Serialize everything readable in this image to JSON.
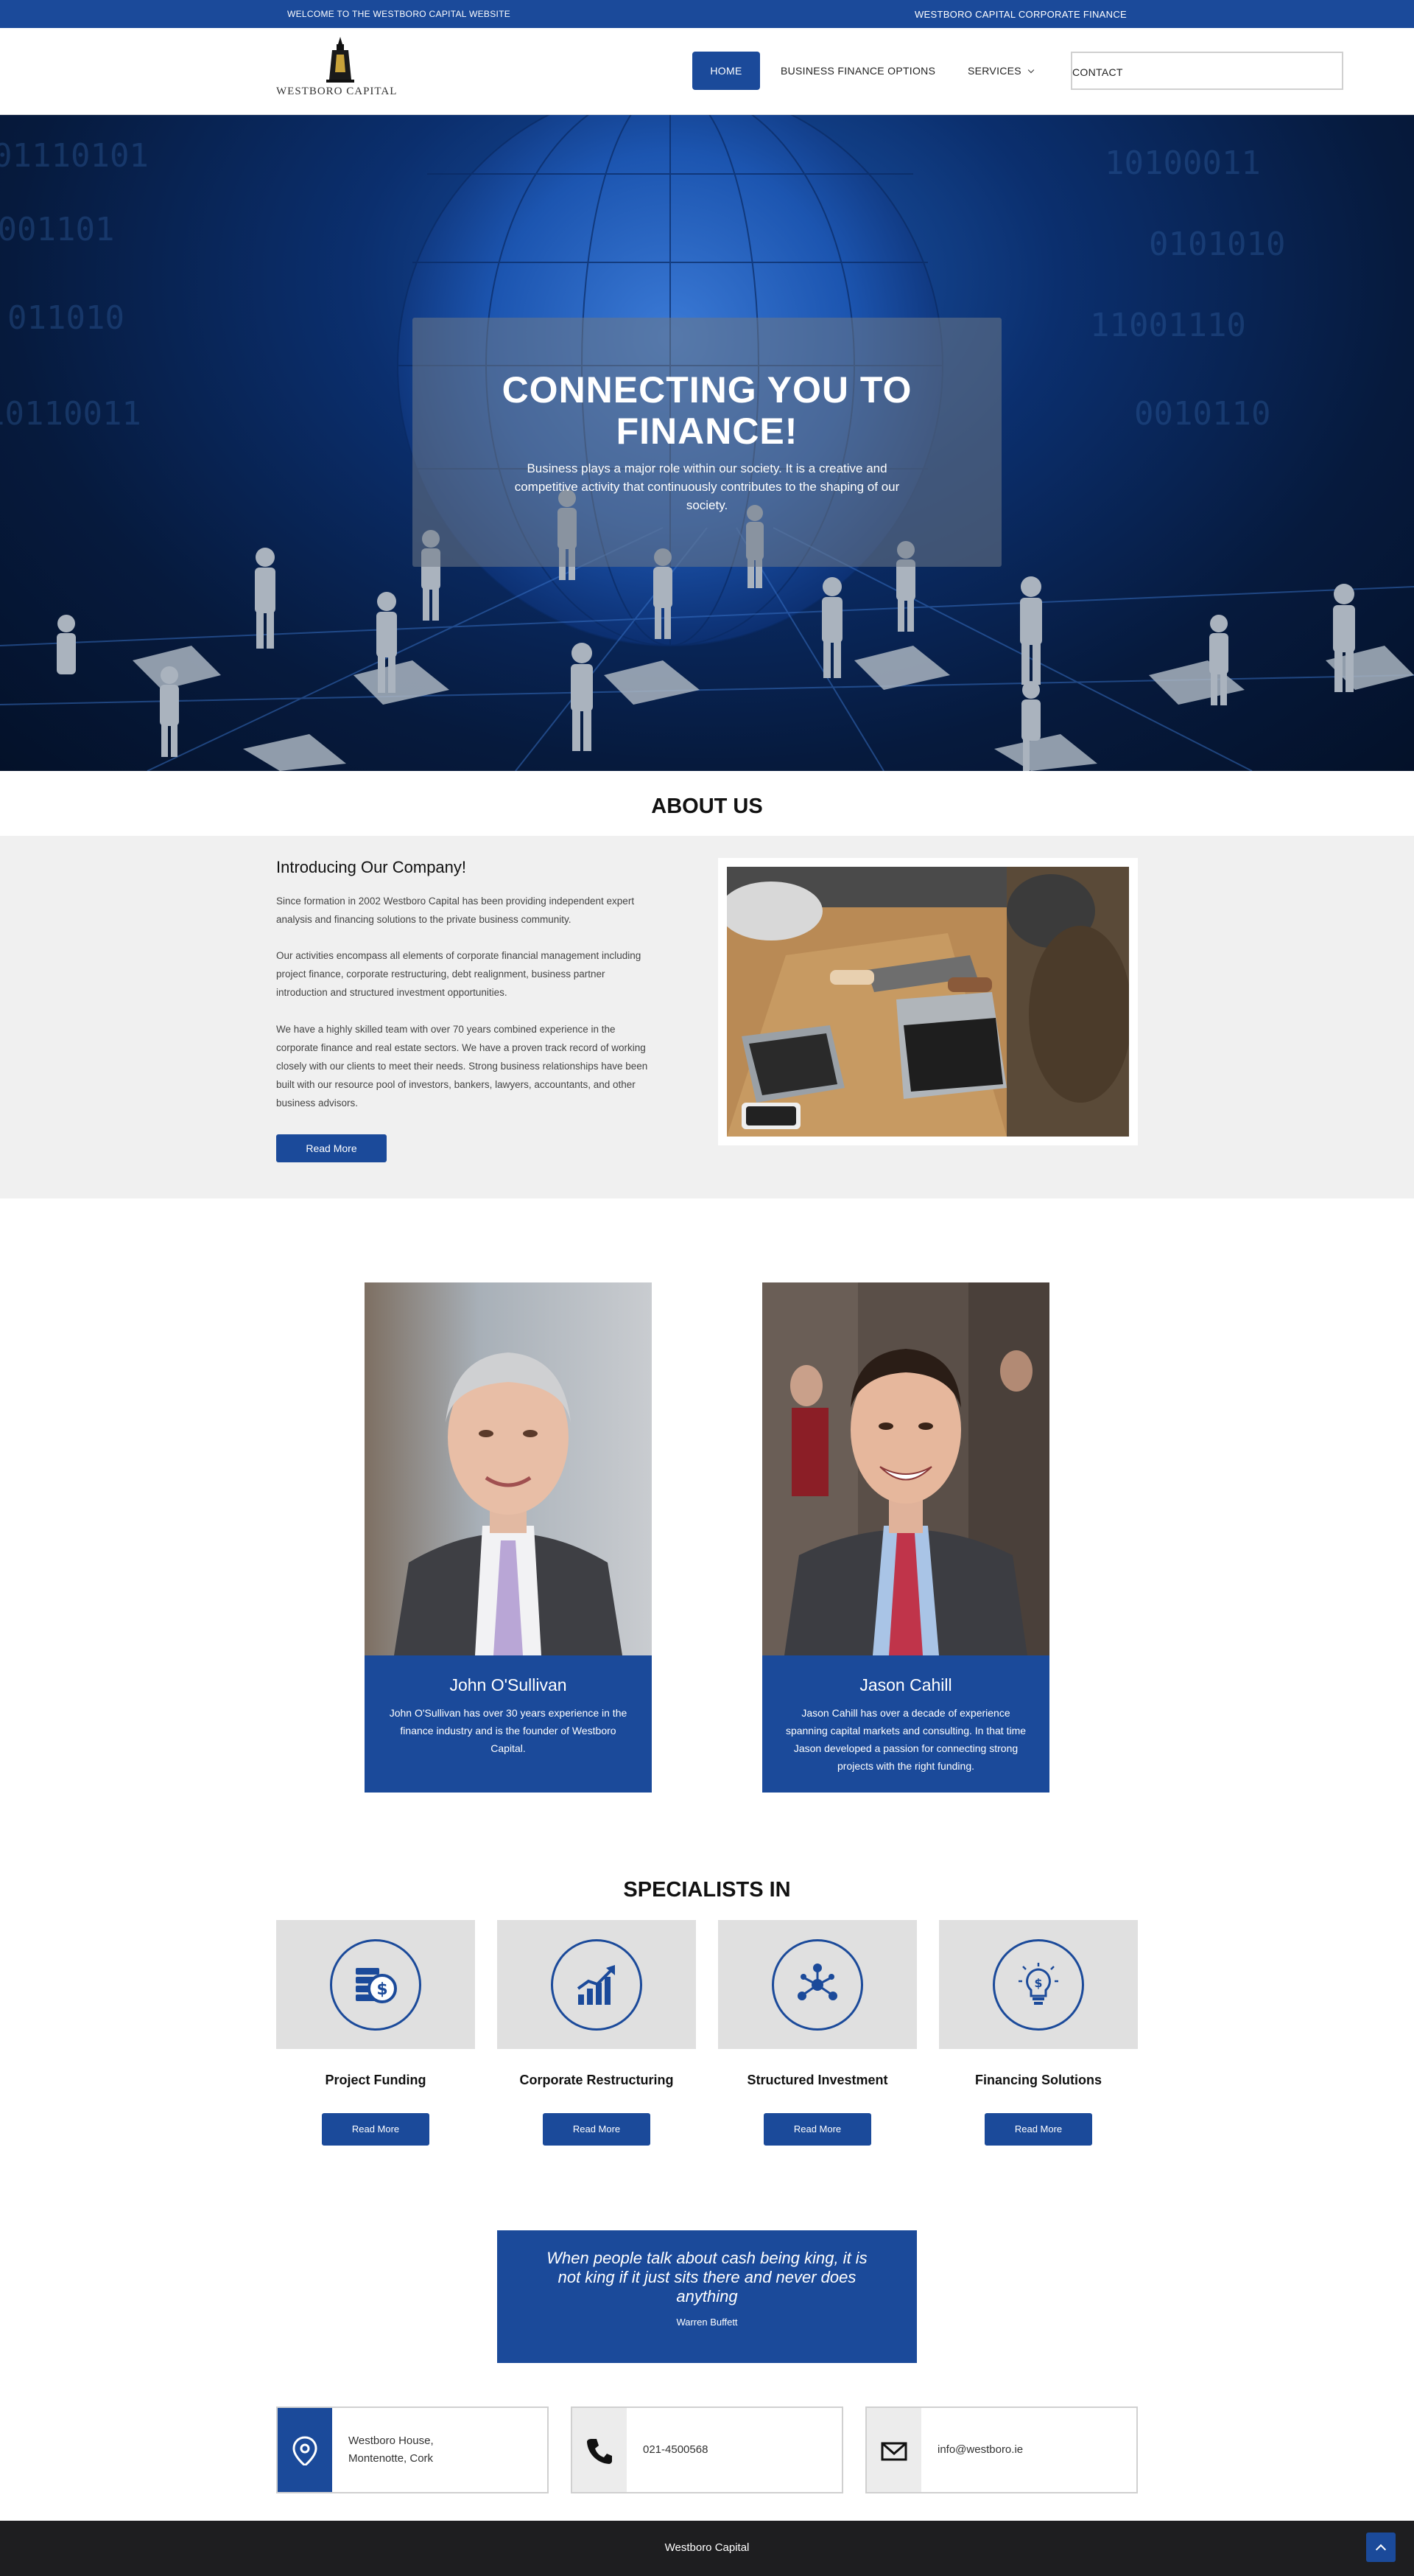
{
  "topbar": {
    "welcome": "WELCOME TO THE WESTBORO CAPITAL WEBSITE",
    "corporate": "WESTBORO CAPITAL CORPORATE FINANCE"
  },
  "header": {
    "logo_text": "WESTBORO CAPITAL",
    "nav": {
      "home": "HOME",
      "business_finance": "BUSINESS FINANCE OPTIONS",
      "services": "SERVICES",
      "contact": "CONTACT"
    }
  },
  "hero": {
    "title": "CONNECTING YOU TO FINANCE!",
    "subtitle": "Business plays a major role within our society. It is a creative and competitive activity that continuously contributes to the shaping of our society."
  },
  "about": {
    "heading": "ABOUT US",
    "intro_title": "Introducing Our Company!",
    "p1": "Since formation in 2002 Westboro Capital has been providing independent expert analysis and financing solutions to the private business community.",
    "p2": "Our activities encompass all elements of corporate financial management including project finance, corporate restructuring, debt realignment, business partner introduction and structured investment opportunities.",
    "p3": "We have a highly skilled team with over 70 years combined experience in the corporate finance and real estate sectors. We have a proven track record of working closely with our clients to meet their needs. Strong business relationships have been built with our resource pool of investors, bankers, lawyers, accountants, and other business advisors.",
    "read_more": "Read More"
  },
  "team": [
    {
      "name": "John O'Sullivan",
      "bio": "John O'Sullivan has over 30 years experience in the finance industry and is the founder of Westboro Capital."
    },
    {
      "name": "Jason Cahill",
      "bio": "Jason Cahill has over a decade of experience spanning capital markets and consulting. In that time Jason developed a passion for connecting strong projects with the right funding."
    }
  ],
  "specialists": {
    "heading": "SPECIALISTS IN",
    "items": [
      {
        "label": "Project Funding",
        "icon": "money-dollar-icon",
        "button": "Read More"
      },
      {
        "label": "Corporate Restructuring",
        "icon": "growth-chart-icon",
        "button": "Read More"
      },
      {
        "label": "Structured Investment",
        "icon": "network-nodes-icon",
        "button": "Read More"
      },
      {
        "label": "Financing Solutions",
        "icon": "lightbulb-dollar-icon",
        "button": "Read More"
      }
    ]
  },
  "quote": {
    "text": "When people talk about cash being king, it is not king if it just sits there and never does anything",
    "author": "Warren Buffett"
  },
  "contact": {
    "address_line1": "Westboro House,",
    "address_line2": "Montenotte, Cork",
    "phone": "021-4500568",
    "email": "info@westboro.ie"
  },
  "footer": {
    "text": "Westboro Capital"
  },
  "colors": {
    "brand_blue": "#1b4a9a",
    "footer_dark": "#1e1e20",
    "section_gray": "#f0f0f0"
  }
}
